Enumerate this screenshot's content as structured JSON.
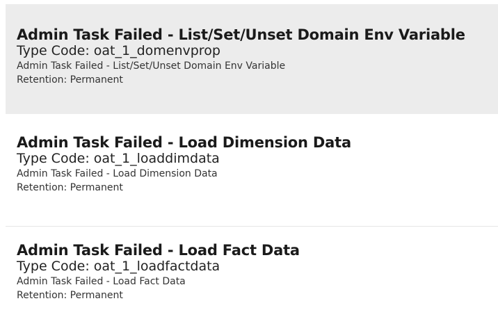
{
  "items": [
    {
      "title": "Admin Task Failed - List/Set/Unset Domain Env Variable",
      "type_code": "Type Code: oat_1_domenvprop",
      "description": "Admin Task Failed - List/Set/Unset Domain Env Variable",
      "retention": "Retention: Permanent",
      "selected": true
    },
    {
      "title": "Admin Task Failed - Load Dimension Data",
      "type_code": "Type Code: oat_1_loaddimdata",
      "description": "Admin Task Failed - Load Dimension Data",
      "retention": "Retention: Permanent",
      "selected": false
    },
    {
      "title": "Admin Task Failed - Load Fact Data",
      "type_code": "Type Code: oat_1_loadfactdata",
      "description": "Admin Task Failed - Load Fact Data",
      "retention": "Retention: Permanent",
      "selected": false
    }
  ]
}
